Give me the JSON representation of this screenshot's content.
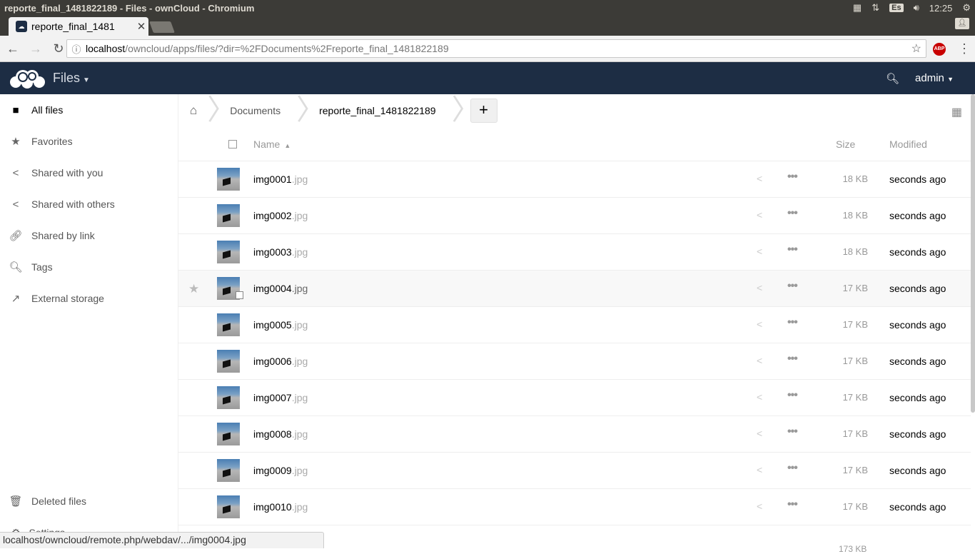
{
  "os": {
    "window_title": "reporte_final_1481822189 - Files - ownCloud - Chromium",
    "keyboard": "Es",
    "clock": "12:25"
  },
  "browser": {
    "tab_title": "reporte_final_1481",
    "url_host": "localhost",
    "url_path": "/owncloud/apps/files/?dir=%2FDocuments%2Freporte_final_1481822189",
    "adblock_label": "ABP",
    "status_url": "localhost/owncloud/remote.php/webdav/.../img0004.jpg"
  },
  "header": {
    "app_name": "Files",
    "user": "admin"
  },
  "sidebar": {
    "items": [
      {
        "label": "All files",
        "icon": "folder-icon"
      },
      {
        "label": "Favorites",
        "icon": "star-icon"
      },
      {
        "label": "Shared with you",
        "icon": "share-icon"
      },
      {
        "label": "Shared with others",
        "icon": "share-icon"
      },
      {
        "label": "Shared by link",
        "icon": "link-icon"
      },
      {
        "label": "Tags",
        "icon": "search-icon"
      },
      {
        "label": "External storage",
        "icon": "external-icon"
      }
    ],
    "deleted": "Deleted files",
    "settings": "Settings"
  },
  "breadcrumb": {
    "items": [
      "Documents",
      "reporte_final_1481822189"
    ],
    "new_label": "+"
  },
  "table": {
    "col_name": "Name",
    "col_size": "Size",
    "col_modified": "Modified",
    "rows": [
      {
        "name": "img0001",
        "ext": ".jpg",
        "size": "18 KB",
        "modified": "seconds ago"
      },
      {
        "name": "img0002",
        "ext": ".jpg",
        "size": "18 KB",
        "modified": "seconds ago"
      },
      {
        "name": "img0003",
        "ext": ".jpg",
        "size": "18 KB",
        "modified": "seconds ago"
      },
      {
        "name": "img0004",
        "ext": ".jpg",
        "size": "17 KB",
        "modified": "seconds ago"
      },
      {
        "name": "img0005",
        "ext": ".jpg",
        "size": "17 KB",
        "modified": "seconds ago"
      },
      {
        "name": "img0006",
        "ext": ".jpg",
        "size": "17 KB",
        "modified": "seconds ago"
      },
      {
        "name": "img0007",
        "ext": ".jpg",
        "size": "17 KB",
        "modified": "seconds ago"
      },
      {
        "name": "img0008",
        "ext": ".jpg",
        "size": "17 KB",
        "modified": "seconds ago"
      },
      {
        "name": "img0009",
        "ext": ".jpg",
        "size": "17 KB",
        "modified": "seconds ago"
      },
      {
        "name": "img0010",
        "ext": ".jpg",
        "size": "17 KB",
        "modified": "seconds ago"
      }
    ],
    "total_size": "173 KB"
  },
  "colors": {
    "header_bg": "#1d2d44"
  }
}
